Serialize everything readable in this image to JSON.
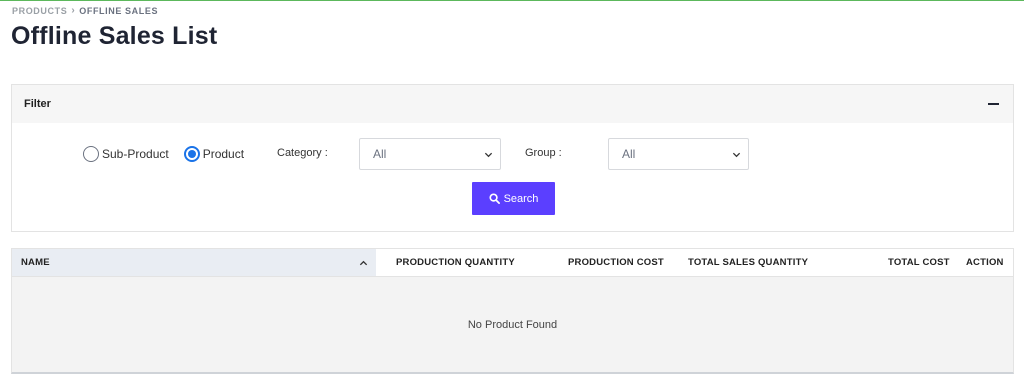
{
  "breadcrumb": {
    "parent": "PRODUCTS",
    "current": "OFFLINE SALES"
  },
  "page": {
    "title": "Offline Sales List"
  },
  "filter": {
    "title": "Filter",
    "radios": [
      {
        "label": "Sub-Product",
        "checked": false
      },
      {
        "label": "Product",
        "checked": true
      }
    ],
    "category_label": "Category :",
    "category_value": "All",
    "group_label": "Group :",
    "group_value": "All",
    "search_label": "Search"
  },
  "table": {
    "columns": [
      "NAME",
      "PRODUCTION QUANTITY",
      "PRODUCTION COST",
      "TOTAL SALES QUANTITY",
      "TOTAL COST",
      "ACTION"
    ],
    "empty_message": "No Product Found"
  },
  "colors": {
    "accent": "#5b3fff",
    "radio": "#1a73e8",
    "top_line": "#5cb85c"
  },
  "icons": [
    "chevron-right-icon",
    "minus-icon",
    "chevron-down-icon",
    "search-icon",
    "sort-up-icon"
  ]
}
